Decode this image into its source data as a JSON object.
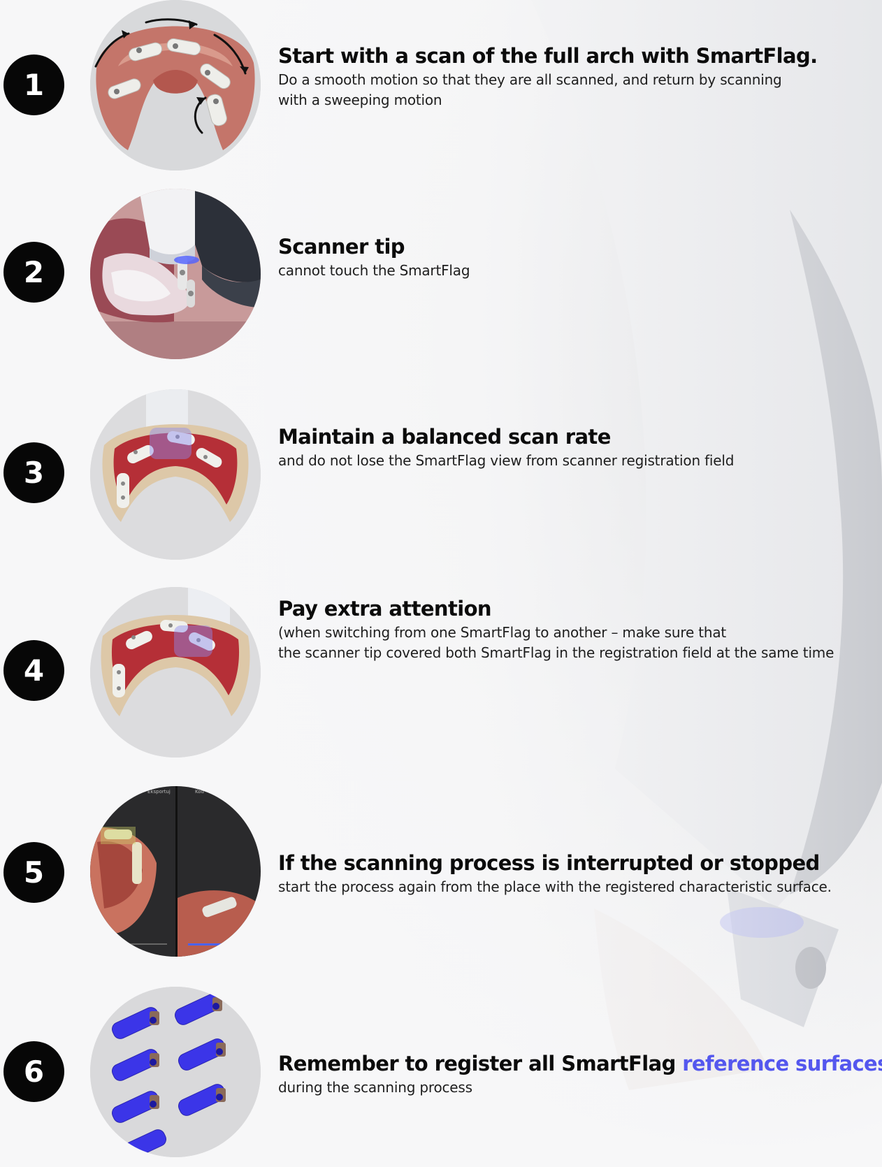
{
  "colors": {
    "badge": "#070707",
    "badge_text": "#ffffff",
    "title": "#0b0b0b",
    "accent": "#5457ee",
    "background": "#f7f7f8"
  },
  "steps": [
    {
      "number": "1",
      "image": "full-arch-scan-with-arrows",
      "title": "Start with a scan of the full arch with SmartFlag.",
      "desc_lines": [
        "Do a smooth motion so that they are all scanned, and return by scanning",
        "with a sweeping motion"
      ]
    },
    {
      "number": "2",
      "image": "scanner-tip-in-mouth",
      "title": "Scanner tip",
      "desc_lines": [
        "cannot touch the SmartFlag"
      ]
    },
    {
      "number": "3",
      "image": "balanced-scan-arch",
      "title": "Maintain a balanced scan rate",
      "desc_lines": [
        " and do not lose the SmartFlag view from scanner registration field"
      ]
    },
    {
      "number": "4",
      "image": "switching-smartflags-arch",
      "title": "Pay extra attention",
      "desc_lines": [
        "(when switching from one SmartFlag to another – make sure that",
        "the scanner tip covered both SmartFlag in the registration field at the same time"
      ]
    },
    {
      "number": "5",
      "image": "scanning-software-screenshot",
      "ui_labels": [
        "Eksportuj",
        "Kod"
      ],
      "title": "If the scanning process is interrupted or stopped",
      "desc_lines": [
        "start the process again from the place with the registered characteristic surface."
      ]
    },
    {
      "number": "6",
      "image": "smartflag-reference-surfaces",
      "title": "Remember to register all SmartFlag ",
      "title_accent": "reference surfaces",
      "desc_lines": [
        "during the scanning process"
      ]
    }
  ]
}
